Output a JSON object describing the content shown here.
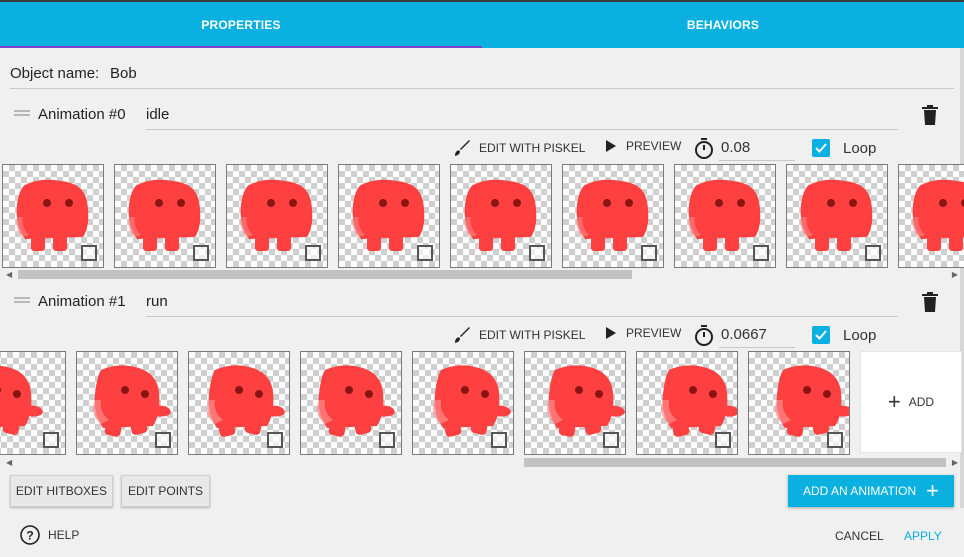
{
  "tabs": [
    {
      "label": "PROPERTIES",
      "active": true
    },
    {
      "label": "BEHAVIORS",
      "active": false
    }
  ],
  "object": {
    "label": "Object name:",
    "value": "Bob"
  },
  "animations": [
    {
      "label": "Animation #0",
      "name": "idle",
      "timer": "0.08",
      "loop_label": "Loop",
      "loop_checked": true,
      "frame_count_visible": 9,
      "sprite_poses": [
        "idle",
        "idle",
        "idle",
        "idle",
        "idle",
        "idle",
        "idle",
        "idle",
        "idle"
      ]
    },
    {
      "label": "Animation #1",
      "name": "run",
      "timer": "0.0667",
      "loop_label": "Loop",
      "loop_checked": true,
      "frame_count_visible": 8,
      "sprite_poses": [
        "run-a",
        "run-b",
        "run-c",
        "run-d",
        "run-e",
        "run-f",
        "run-g",
        "run-h"
      ]
    }
  ],
  "tools": {
    "edit_piskel": "EDIT WITH PISKEL",
    "preview": "PREVIEW"
  },
  "add_tile_label": "ADD",
  "buttons": {
    "edit_hitboxes": "EDIT HITBOXES",
    "edit_points": "EDIT POINTS",
    "add_animation": "ADD AN ANIMATION"
  },
  "footer": {
    "help": "HELP",
    "cancel": "CANCEL",
    "apply": "APPLY"
  },
  "colors": {
    "accent": "#09b0e0",
    "tab_indicator": "#7d3fd0",
    "sprite": "#ff4040"
  },
  "icons": [
    "brush-icon",
    "play-icon",
    "timer-icon",
    "checkbox-icon",
    "trash-icon",
    "drag-handle-icon",
    "help-circle-icon",
    "plus-icon"
  ]
}
